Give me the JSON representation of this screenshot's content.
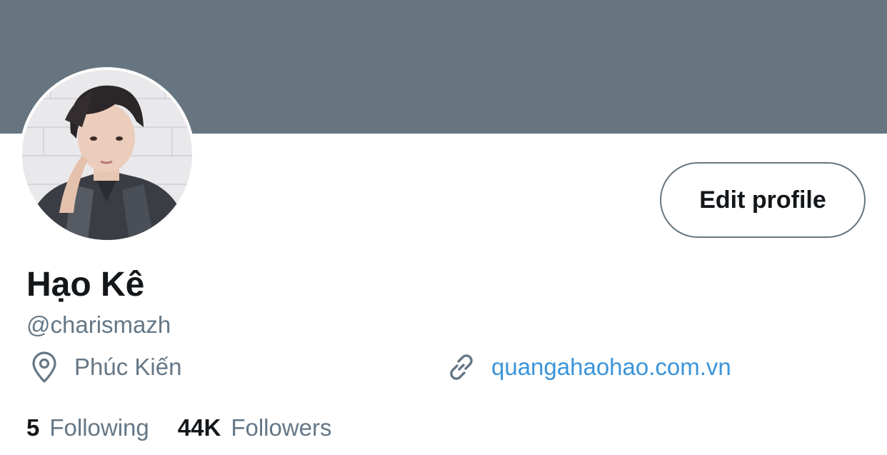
{
  "profile": {
    "name": "Hạo Kê",
    "handle": "@charismazh",
    "location": "Phúc Kiến",
    "website": "quangahaohao.com.vn",
    "edit_label": "Edit profile"
  },
  "stats": {
    "following_count": "5",
    "following_label": "Following",
    "followers_count": "44K",
    "followers_label": "Followers"
  },
  "icons": {
    "location": "map-pin-icon",
    "website": "link-icon"
  },
  "colors": {
    "banner": "#66757f",
    "text_primary": "#14171a",
    "text_secondary": "#657786",
    "link": "#3b94d9",
    "button_border": "#66757f"
  }
}
